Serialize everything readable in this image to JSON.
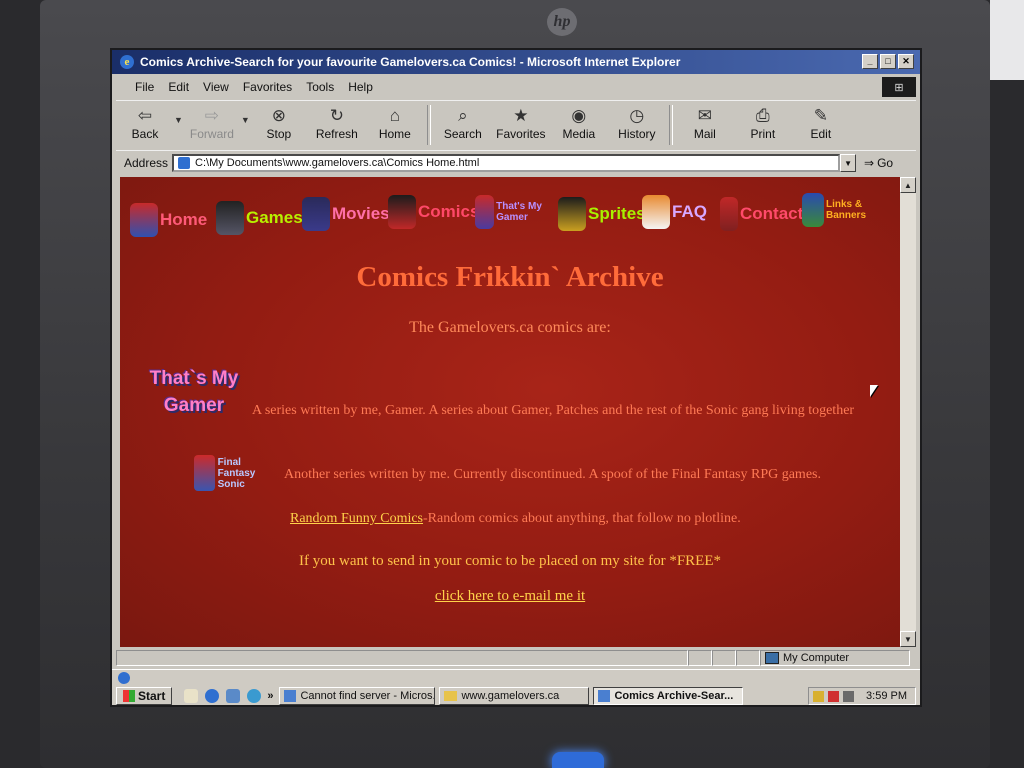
{
  "window": {
    "title": "Comics Archive-Search for your favourite Gamelovers.ca Comics! - Microsoft Internet Explorer"
  },
  "menu": [
    "File",
    "Edit",
    "View",
    "Favorites",
    "Tools",
    "Help"
  ],
  "toolbar": {
    "back": "Back",
    "forward": "Forward",
    "stop": "Stop",
    "refresh": "Refresh",
    "home": "Home",
    "search": "Search",
    "favorites": "Favorites",
    "media": "Media",
    "history": "History",
    "mail": "Mail",
    "print": "Print",
    "edit": "Edit"
  },
  "address": {
    "label": "Address",
    "url": "C:\\My Documents\\www.gamelovers.ca\\Comics Home.html",
    "go": "Go"
  },
  "nav": {
    "home": "Home",
    "games": "Games",
    "movies": "Movies",
    "comics": "Comics",
    "thats_my_gamer": "That's My Gamer",
    "sprites": "Sprites",
    "faq": "FAQ",
    "contact": "Contact",
    "links": "Links & Banners"
  },
  "page": {
    "title": "Comics Frikkin` Archive",
    "intro": "The Gamelovers.ca comics are:",
    "tmg_logo": "That`s My Gamer",
    "tmg_desc": "A series written by me, Gamer. A series about Gamer, Patches and the rest of the Sonic gang living together",
    "ffs_logo": "Final Fantasy Sonic",
    "ffs_desc": "Another series written by me. Currently discontinued. A spoof of the Final Fantasy RPG games.",
    "random_link": "Random Funny Comics",
    "random_desc": "-Random comics about anything, that follow no plotline.",
    "send": "If you want to send in your comic to be placed on my site for *FREE*",
    "email_link": "click here to e-mail me it"
  },
  "statusbar": {
    "zone": "My Computer"
  },
  "taskbar": {
    "start": "Start",
    "tasks": [
      "Cannot find server - Micros...",
      "www.gamelovers.ca",
      "Comics Archive-Sear..."
    ],
    "clock": "3:59 PM"
  },
  "colors": {
    "page_bg": "#9b1f14",
    "title": "#ff6b3a",
    "link": "#ffd24a",
    "text": "#ff7a55"
  }
}
